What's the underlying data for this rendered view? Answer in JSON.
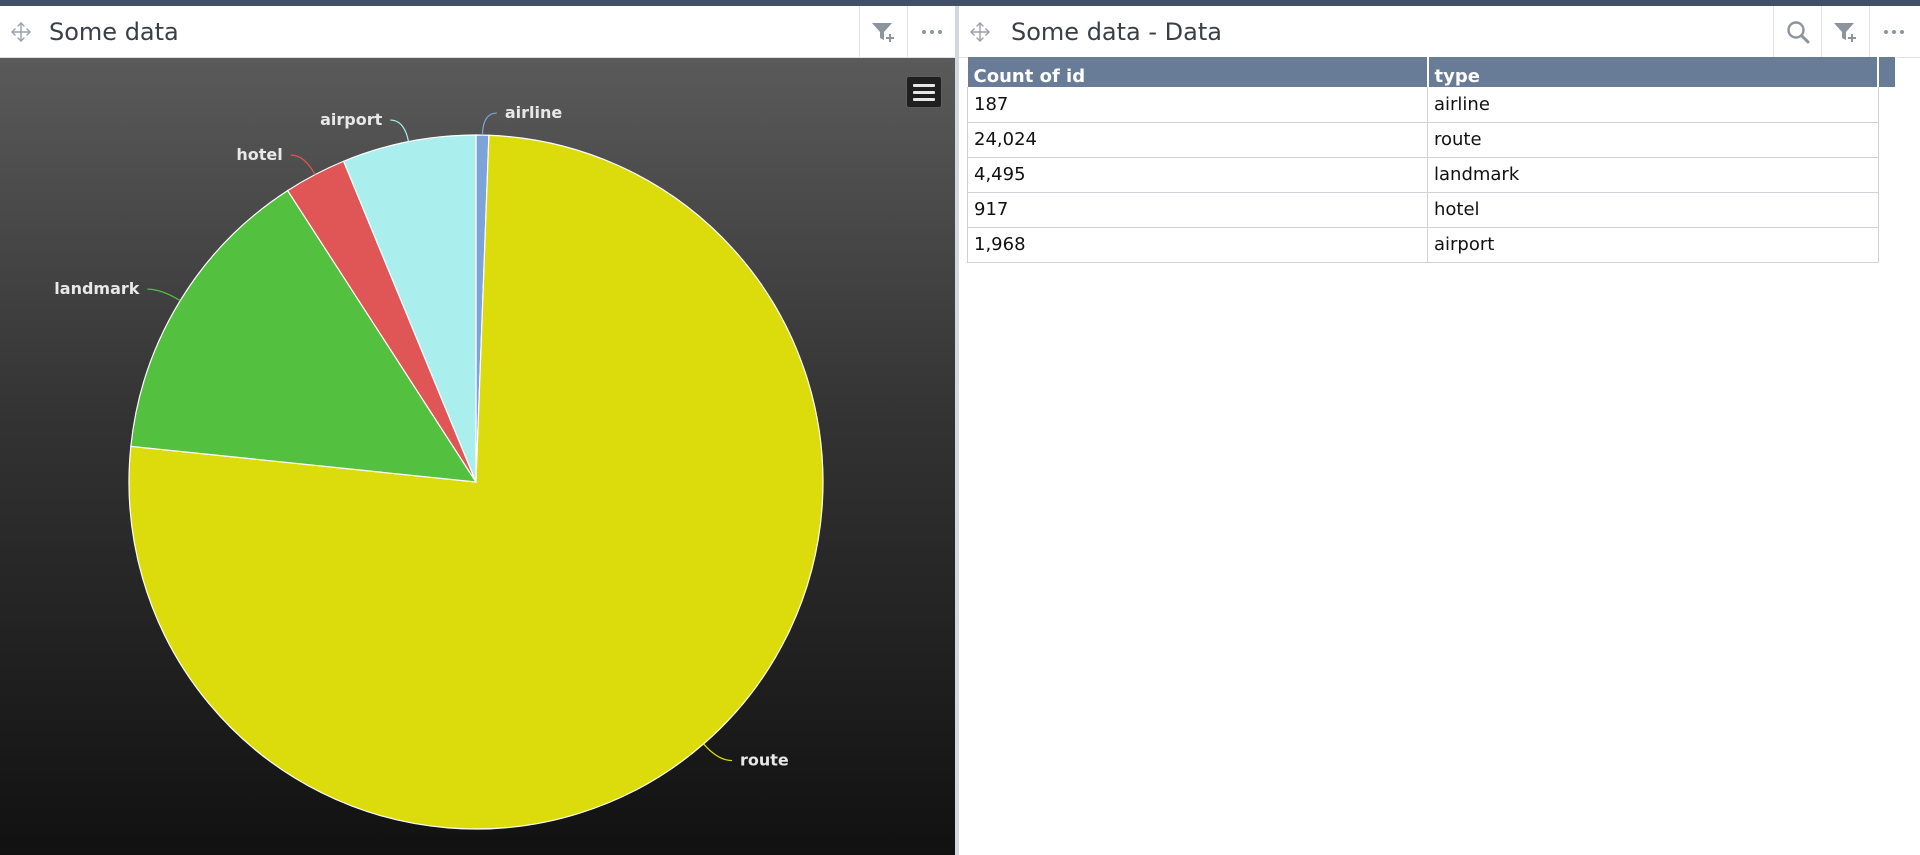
{
  "left_panel": {
    "title": "Some data"
  },
  "right_panel": {
    "title": "Some data - Data"
  },
  "icons": {
    "move": "move-icon",
    "filter": "filter-add-icon",
    "more": "more-icon",
    "search": "search-icon",
    "chart_menu": "hamburger-menu-icon"
  },
  "chart_data": {
    "type": "pie",
    "slices": [
      {
        "label": "airline",
        "value": 187,
        "color": "#7ea3d8"
      },
      {
        "label": "route",
        "value": 24024,
        "color": "#dcdc0c"
      },
      {
        "label": "landmark",
        "value": 4495,
        "color": "#54c040"
      },
      {
        "label": "hotel",
        "value": 917,
        "color": "#e05555"
      },
      {
        "label": "airport",
        "value": 1968,
        "color": "#aaeeee"
      }
    ]
  },
  "table": {
    "headers": [
      "Count of id",
      "type"
    ],
    "rows": [
      [
        "187",
        "airline"
      ],
      [
        "24,024",
        "route"
      ],
      [
        "4,495",
        "landmark"
      ],
      [
        "917",
        "hotel"
      ],
      [
        "1,968",
        "airport"
      ]
    ]
  }
}
